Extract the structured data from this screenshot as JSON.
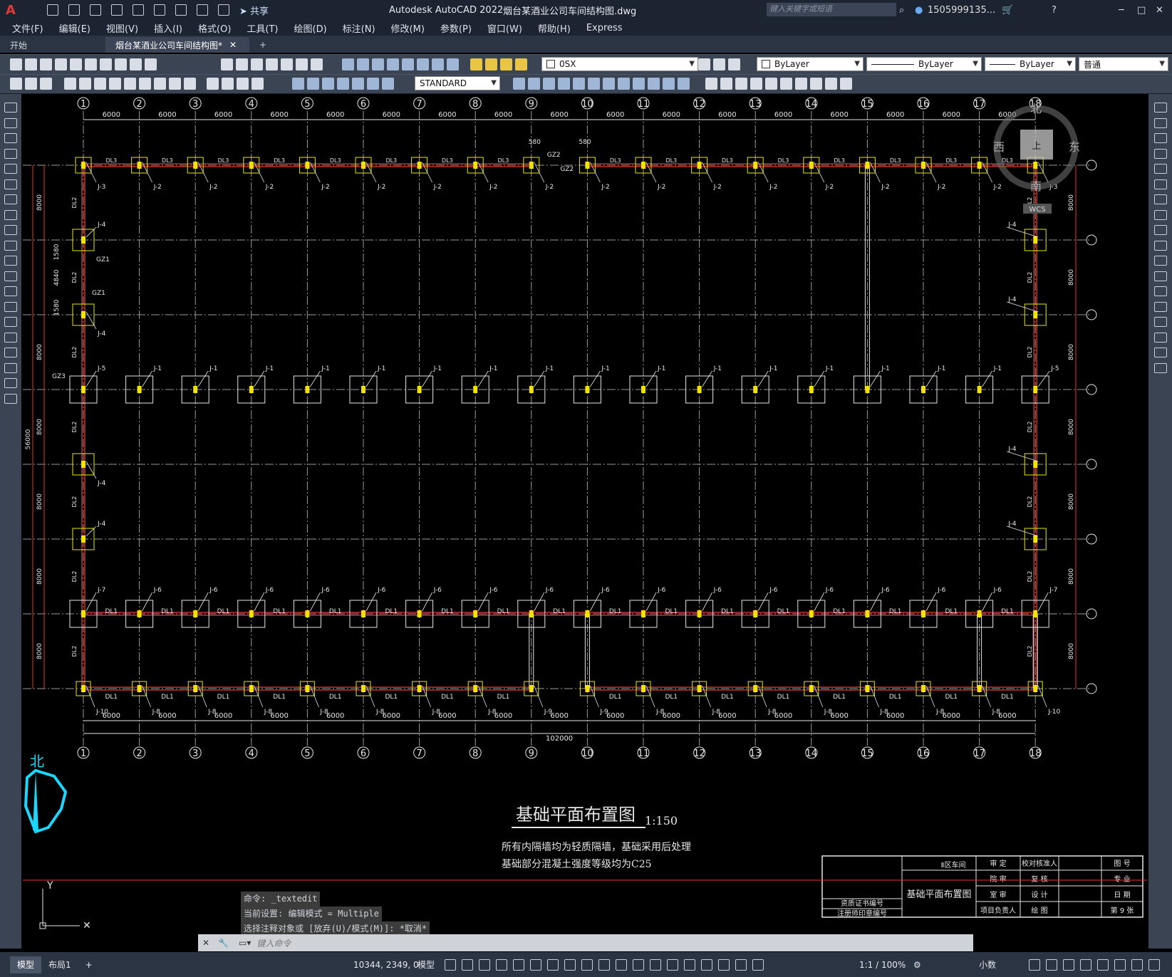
{
  "window": {
    "app_title": "Autodesk AutoCAD 2022",
    "file_title": "烟台某酒业公司车间结构图.dwg",
    "search_placeholder": "键入关键字或短语",
    "user": "1505999135...",
    "share_label": "共享"
  },
  "menu": [
    "文件(F)",
    "编辑(E)",
    "视图(V)",
    "插入(I)",
    "格式(O)",
    "工具(T)",
    "绘图(D)",
    "标注(N)",
    "修改(M)",
    "参数(P)",
    "窗口(W)",
    "帮助(H)",
    "Express"
  ],
  "tabs": [
    {
      "label": "开始",
      "active": false
    },
    {
      "label": "烟台某酒业公司车间结构图*",
      "active": true
    }
  ],
  "toolbar": {
    "layer_value": "0SX",
    "color_value": "ByLayer",
    "linetype_value": "ByLayer",
    "lineweight_value": "ByLayer",
    "plotstyle_value": "普通",
    "textstyle_value": "STANDARD"
  },
  "drawing": {
    "axis_numbers": [
      "1",
      "2",
      "3",
      "4",
      "5",
      "6",
      "7",
      "8",
      "9",
      "10",
      "11",
      "12",
      "13",
      "14",
      "15",
      "16",
      "17",
      "18"
    ],
    "bay_spacing": "6000",
    "total_length": "102000",
    "row_spacing": "8000",
    "total_width": "56000",
    "sub_dims": [
      "1580",
      "4840",
      "1580"
    ],
    "title": "基础平面布置图",
    "scale": "1:150",
    "note_line1": "所有内隔墙均为轻质隔墙，基础采用后处理",
    "note_line2": "基础部分混凝土强度等级均为C25",
    "labels": {
      "j1": "J-1",
      "j2": "J-2",
      "j3": "J-3",
      "j4": "J-4",
      "j5": "J-5",
      "j6": "J-6",
      "j7": "J-7",
      "j8": "J-8",
      "j9": "J-9",
      "j10": "J-10",
      "dl1": "DL1",
      "dl2": "DL2",
      "dl3": "DL3",
      "gz1": "GZ1",
      "gz2": "GZ2",
      "gz3": "GZ3",
      "dim580": "580"
    },
    "viewcube": {
      "north": "北",
      "south": "南",
      "east": "东",
      "west": "西",
      "top": "上",
      "wcs": "WCS"
    },
    "ucs_north": "北"
  },
  "titleblock": {
    "project": "Ⅱ区车间",
    "drawing_name": "基础平面布置图",
    "cells": [
      "审 定",
      "校对核准人",
      "图 号",
      "院 审",
      "复 核",
      "专 业",
      "室 审",
      "设 计",
      "日 期",
      "项目负责人",
      "绘 图",
      "第 9 张",
      "资质证书编号",
      "注册师印章编号"
    ]
  },
  "command": {
    "history": [
      "命令: _textedit",
      "当前设置: 编辑模式 = Multiple",
      "选择注释对象或 [放弃(U)/模式(M)]: *取消*"
    ],
    "placeholder": "键入命令"
  },
  "status": {
    "layout_tabs": [
      "模型",
      "布局1"
    ],
    "coords": "10344, 2349, 0",
    "space": "模型",
    "annoscale": "1:1 / 100%",
    "units": "小数"
  }
}
